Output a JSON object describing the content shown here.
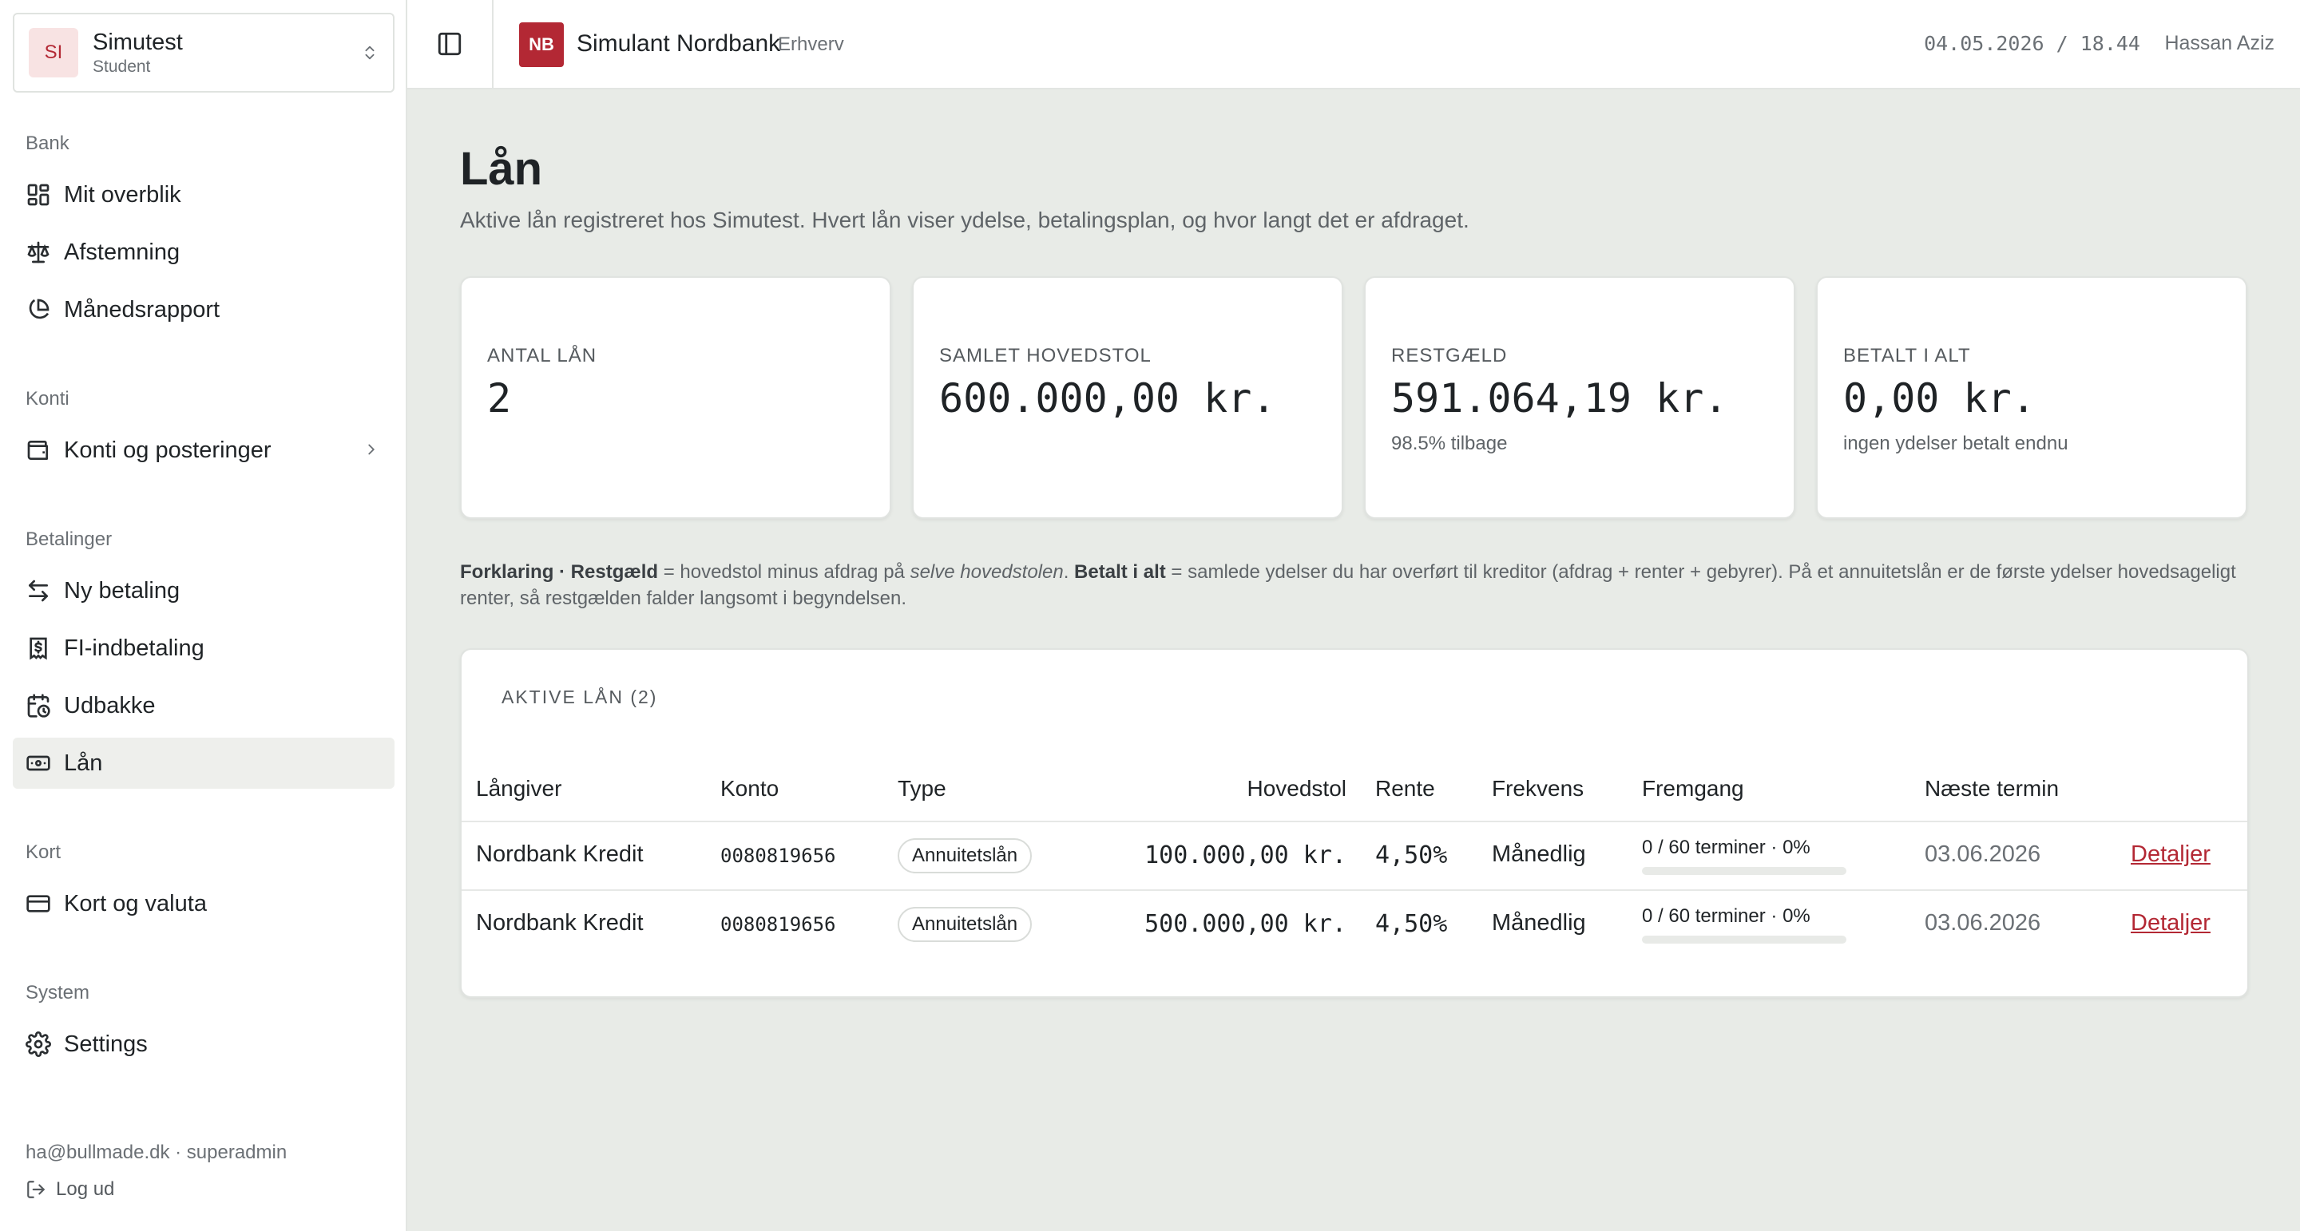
{
  "org": {
    "initials": "SI",
    "name": "Simutest",
    "role": "Student"
  },
  "nav": {
    "bank_label": "Bank",
    "overview": "Mit overblik",
    "reconcile": "Afstemning",
    "monthly": "Månedsrapport",
    "accounts_label": "Konti",
    "accounts": "Konti og posteringer",
    "payments_label": "Betalinger",
    "new_payment": "Ny betaling",
    "fi_payment": "FI-indbetaling",
    "outbox": "Udbakke",
    "loans": "Lån",
    "cards_label": "Kort",
    "cards": "Kort og valuta",
    "system_label": "System",
    "settings": "Settings"
  },
  "session": {
    "user_line": "ha@bullmade.dk · superadmin",
    "logout": "Log ud"
  },
  "topbar": {
    "brand_initials": "NB",
    "brand_name": "Simulant Nordbank",
    "brand_sub": "Erhverv",
    "datetime": "04.05.2026 / 18.44",
    "user": "Hassan Aziz"
  },
  "page": {
    "title": "Lån",
    "subtitle": "Aktive lån registreret hos Simutest. Hvert lån viser ydelse, betalingsplan, og hvor langt det er afdraget."
  },
  "stats": [
    {
      "label": "ANTAL LÅN",
      "value": "2",
      "note": ""
    },
    {
      "label": "SAMLET HOVEDSTOL",
      "value": "600.000,00 kr.",
      "note": ""
    },
    {
      "label": "RESTGÆLD",
      "value": "591.064,19 kr.",
      "note": "98.5% tilbage"
    },
    {
      "label": "BETALT I ALT",
      "value": "0,00 kr.",
      "note": "ingen ydelser betalt endnu"
    }
  ],
  "explanation": {
    "p1": "Forklaring · Restgæld",
    "p2": " = hovedstol minus afdrag på ",
    "p3": "selve hovedstolen",
    "p4": ". ",
    "p5": "Betalt i alt",
    "p6": " = samlede ydelser du har overført til kreditor (afdrag + renter + gebyrer). På et annuitetslån er de første ydelser hovedsageligt renter, så restgælden falder langsomt i begyndelsen."
  },
  "loans": {
    "title": "AKTIVE LÅN (2)",
    "headers": {
      "lender": "Långiver",
      "account": "Konto",
      "type": "Type",
      "principal": "Hovedstol",
      "rate": "Rente",
      "frequency": "Frekvens",
      "progress": "Fremgang",
      "next": "Næste termin"
    },
    "rows": [
      {
        "lender": "Nordbank Kredit",
        "account": "0080819656",
        "type": "Annuitetslån",
        "principal": "100.000,00 kr.",
        "rate": "4,50%",
        "frequency": "Månedlig",
        "progress_text": "0 / 60 terminer · 0%",
        "progress_fraction": 0,
        "next": "03.06.2026",
        "link": "Detaljer"
      },
      {
        "lender": "Nordbank Kredit",
        "account": "0080819656",
        "type": "Annuitetslån",
        "principal": "500.000,00 kr.",
        "rate": "4,50%",
        "frequency": "Månedlig",
        "progress_text": "0 / 60 terminer · 0%",
        "progress_fraction": 0,
        "next": "03.06.2026",
        "link": "Detaljer"
      }
    ]
  },
  "colors": {
    "accent": "#b32834",
    "background": "#e8ebe7",
    "active_nav": "#eeefec"
  },
  "icons": {
    "org_switch": "chevrons-up-down-icon",
    "overview": "layout-grid-icon",
    "reconcile": "scale-icon",
    "monthly": "pie-chart-icon",
    "accounts": "wallet-icon",
    "new_payment": "arrows-left-right-icon",
    "fi_payment": "receipt-dollar-icon",
    "outbox": "calendar-clock-icon",
    "loans": "banknote-icon",
    "cards": "credit-card-icon",
    "settings": "gear-icon",
    "logout": "log-out-icon",
    "sidebar_toggle": "panel-left-icon"
  }
}
